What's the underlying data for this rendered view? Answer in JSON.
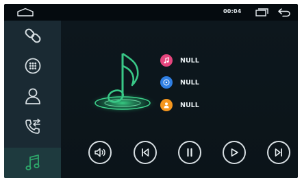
{
  "statusbar": {
    "clock": "00:04",
    "home_icon": "home-icon",
    "recents_icon": "recents-icon",
    "back_icon": "back-icon"
  },
  "sidebar": {
    "items": [
      {
        "icon": "link-icon",
        "active": false
      },
      {
        "icon": "dialpad-icon",
        "active": false
      },
      {
        "icon": "contacts-icon",
        "active": false
      },
      {
        "icon": "call-log-icon",
        "active": false
      },
      {
        "icon": "music-icon",
        "active": true
      }
    ],
    "active_color": "#2ea86b"
  },
  "track_info": {
    "title": "NULL",
    "artist": "NULL",
    "album": "NULL",
    "title_icon_color": "#e5457d",
    "artist_icon_color": "#2f7fe3",
    "album_icon_color": "#f5961e"
  },
  "controls": {
    "icons": [
      "volume-icon",
      "previous-icon",
      "pause-icon",
      "play-icon",
      "next-icon"
    ]
  },
  "colors": {
    "accent": "#2ea86b",
    "background": "#0a1319",
    "sidebar": "#1a2a33"
  }
}
